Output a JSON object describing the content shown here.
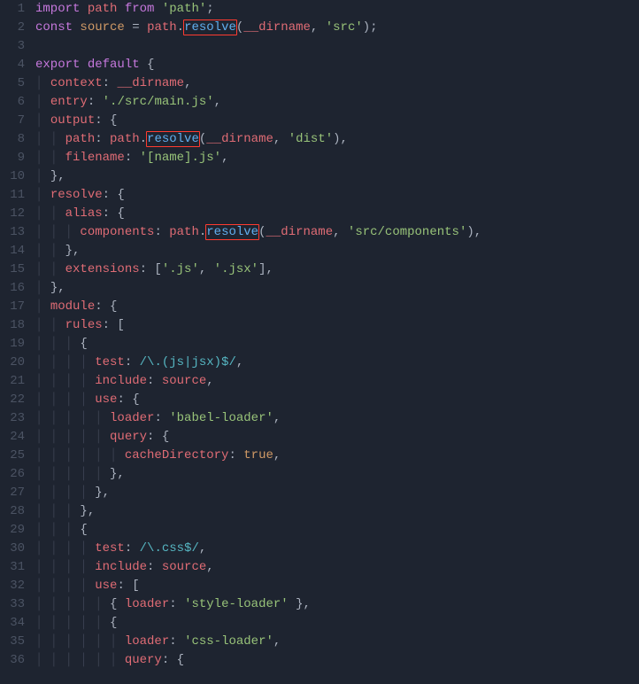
{
  "lines": {
    "l1": {
      "n": "1",
      "import": "import",
      "path": "path",
      "from": "from",
      "str": "'path'",
      "semi": ";"
    },
    "l2": {
      "n": "2",
      "const": "const",
      "source": "source",
      "eq": " = ",
      "pathvar": "path",
      "dot": ".",
      "resolve": "resolve",
      "open": "(",
      "dirname": "__dirname",
      "comma": ", ",
      "str": "'src'",
      "close": ")",
      "semi": ";"
    },
    "l3": {
      "n": "3"
    },
    "l4": {
      "n": "4",
      "export": "export",
      "default": "default",
      "brace": " {"
    },
    "l5": {
      "n": "5",
      "key": "context",
      "colon": ": ",
      "val": "__dirname",
      "comma": ","
    },
    "l6": {
      "n": "6",
      "key": "entry",
      "colon": ": ",
      "val": "'./src/main.js'",
      "comma": ","
    },
    "l7": {
      "n": "7",
      "key": "output",
      "colon": ": {",
      "comma": ""
    },
    "l8": {
      "n": "8",
      "key": "path",
      "colon": ": ",
      "pathvar": "path",
      "dot": ".",
      "resolve": "resolve",
      "open": "(",
      "dirname": "__dirname",
      "comma1": ", ",
      "str": "'dist'",
      "close": ")",
      "comma": ","
    },
    "l9": {
      "n": "9",
      "key": "filename",
      "colon": ": ",
      "val": "'[name].js'",
      "comma": ","
    },
    "l10": {
      "n": "10",
      "close": "},"
    },
    "l11": {
      "n": "11",
      "key": "resolve",
      "colon": ": {"
    },
    "l12": {
      "n": "12",
      "key": "alias",
      "colon": ": {"
    },
    "l13": {
      "n": "13",
      "key": "components",
      "colon": ": ",
      "pathvar": "path",
      "dot": ".",
      "resolve": "resolve",
      "open": "(",
      "dirname": "__dirname",
      "comma1": ", ",
      "str": "'src/components'",
      "close": ")",
      "comma": ","
    },
    "l14": {
      "n": "14",
      "close": "},"
    },
    "l15": {
      "n": "15",
      "key": "extensions",
      "colon": ": [",
      "s1": "'.js'",
      "comma1": ", ",
      "s2": "'.jsx'",
      "close": "],"
    },
    "l16": {
      "n": "16",
      "close": "},"
    },
    "l17": {
      "n": "17",
      "key": "module",
      "colon": ": {"
    },
    "l18": {
      "n": "18",
      "key": "rules",
      "colon": ": ["
    },
    "l19": {
      "n": "19",
      "open": "{"
    },
    "l20": {
      "n": "20",
      "key": "test",
      "colon": ": ",
      "regex": "/\\.(js|jsx)$/",
      "comma": ","
    },
    "l21": {
      "n": "21",
      "key": "include",
      "colon": ": ",
      "val": "source",
      "comma": ","
    },
    "l22": {
      "n": "22",
      "key": "use",
      "colon": ": {"
    },
    "l23": {
      "n": "23",
      "key": "loader",
      "colon": ": ",
      "val": "'babel-loader'",
      "comma": ","
    },
    "l24": {
      "n": "24",
      "key": "query",
      "colon": ": {"
    },
    "l25": {
      "n": "25",
      "key": "cacheDirectory",
      "colon": ": ",
      "val": "true",
      "comma": ","
    },
    "l26": {
      "n": "26",
      "close": "},"
    },
    "l27": {
      "n": "27",
      "close": "},"
    },
    "l28": {
      "n": "28",
      "close": "},"
    },
    "l29": {
      "n": "29",
      "open": "{"
    },
    "l30": {
      "n": "30",
      "key": "test",
      "colon": ": ",
      "regex": "/\\.css$/",
      "comma": ","
    },
    "l31": {
      "n": "31",
      "key": "include",
      "colon": ": ",
      "val": "source",
      "comma": ","
    },
    "l32": {
      "n": "32",
      "key": "use",
      "colon": ": ["
    },
    "l33": {
      "n": "33",
      "open": "{ ",
      "key": "loader",
      "colon": ": ",
      "val": "'style-loader'",
      "close": " },"
    },
    "l34": {
      "n": "34",
      "open": "{"
    },
    "l35": {
      "n": "35",
      "key": "loader",
      "colon": ": ",
      "val": "'css-loader'",
      "comma": ","
    },
    "l36": {
      "n": "36",
      "key": "query",
      "colon": ": {"
    }
  }
}
